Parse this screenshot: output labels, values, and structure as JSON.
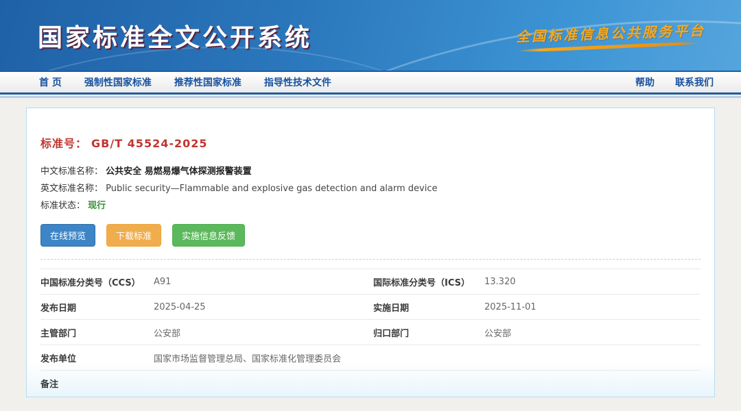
{
  "header": {
    "title": "国家标准全文公开系统",
    "slogan": "全国标准信息公共服务平台"
  },
  "nav": {
    "items": [
      {
        "label": "首 页"
      },
      {
        "label": "强制性国家标准"
      },
      {
        "label": "推荐性国家标准"
      },
      {
        "label": "指导性技术文件"
      }
    ],
    "right_items": [
      {
        "label": "帮助"
      },
      {
        "label": "联系我们"
      }
    ]
  },
  "detail": {
    "standard_no_label": "标准号：",
    "standard_no": "GB/T 45524-2025",
    "cn_name_label": "中文标准名称：",
    "cn_name": "公共安全 易燃易爆气体探测报警装置",
    "en_name_label": "英文标准名称：",
    "en_name": "Public security—Flammable and explosive gas detection and alarm device",
    "status_label": "标准状态：",
    "status": "现行",
    "buttons": {
      "preview": "在线预览",
      "download": "下载标准",
      "feedback": "实施信息反馈"
    },
    "rows": [
      {
        "cells": [
          {
            "label": "中国标准分类号（CCS）",
            "value": "A91"
          },
          {
            "label": "国际标准分类号（ICS）",
            "value": "13.320"
          }
        ]
      },
      {
        "cells": [
          {
            "label": "发布日期",
            "value": "2025-04-25"
          },
          {
            "label": "实施日期",
            "value": "2025-11-01"
          }
        ]
      },
      {
        "cells": [
          {
            "label": "主管部门",
            "value": "公安部"
          },
          {
            "label": "归口部门",
            "value": "公安部"
          }
        ]
      },
      {
        "cells": [
          {
            "label": "发布单位",
            "value": "国家市场监督管理总局、国家标准化管理委员会"
          }
        ]
      },
      {
        "cells": [
          {
            "label": "备注",
            "value": ""
          }
        ]
      }
    ]
  },
  "colors": {
    "header_blue_start": "#1f61a7",
    "header_blue_end": "#55a5dd",
    "slogan_orange": "#f8a81e",
    "nav_text_blue": "#17519e",
    "standard_no_red": "#c03530",
    "status_green": "#3a8f3a",
    "btn_preview_blue": "#3d85c6",
    "btn_download_orange": "#f0ad4e",
    "btn_feedback_green": "#5cb85c",
    "card_border_blue": "#b5ddef",
    "page_bg": "#f1f0ed"
  }
}
